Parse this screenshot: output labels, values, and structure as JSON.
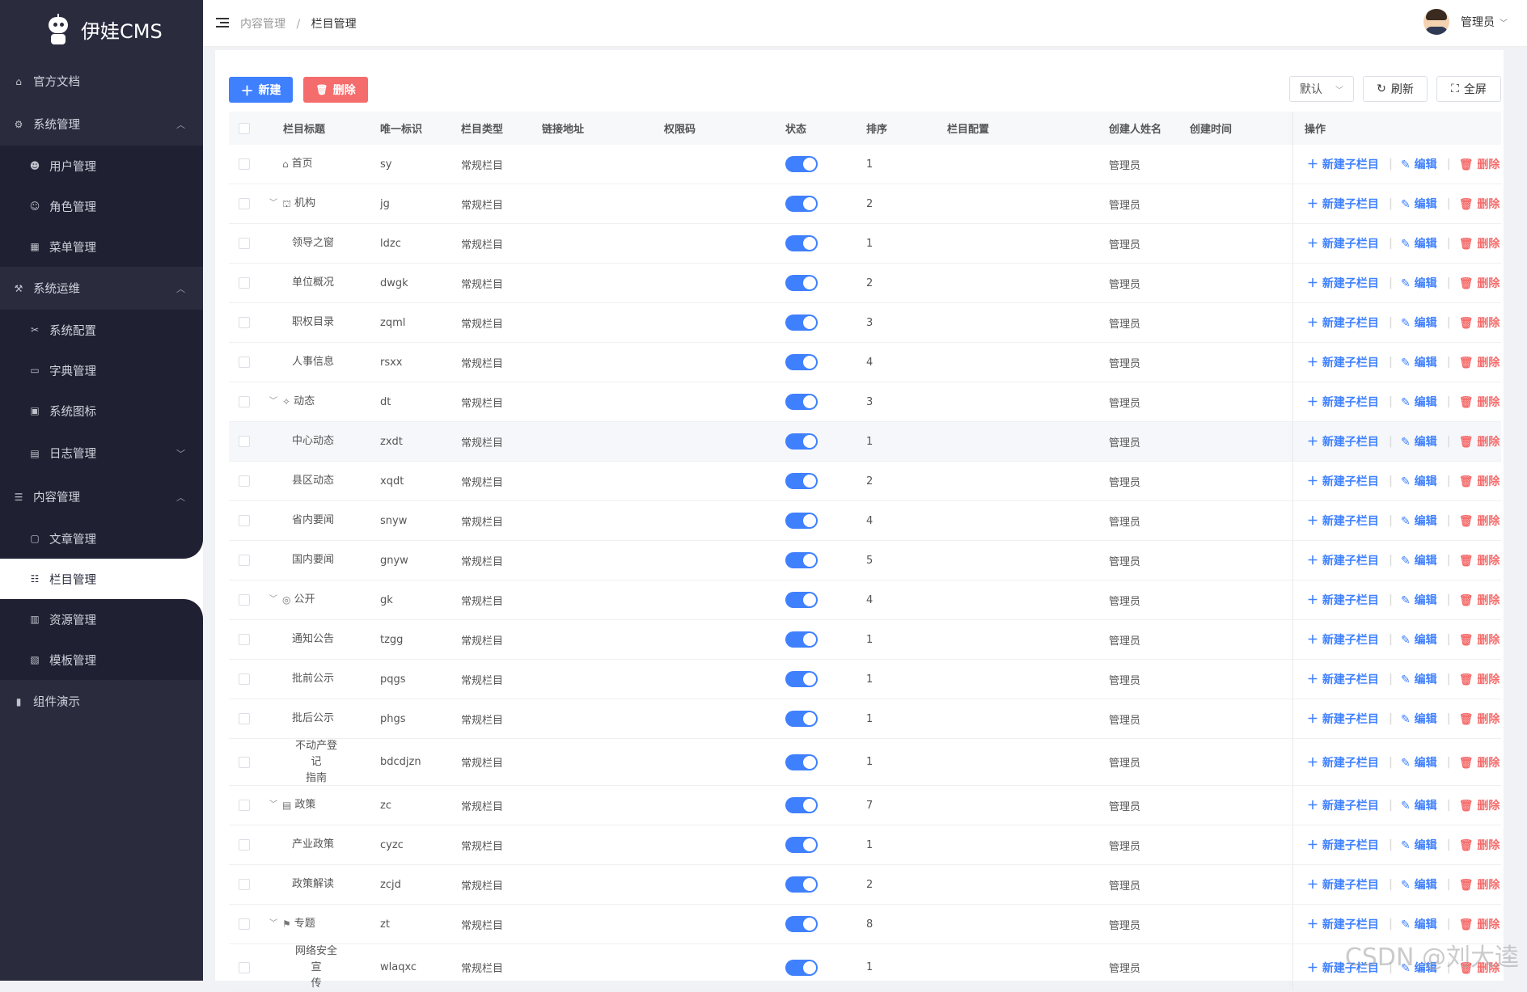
{
  "app": {
    "name": "伊娃CMS"
  },
  "sidebar": {
    "items": [
      {
        "label": "官方文档",
        "icon": "home-icon"
      },
      {
        "label": "系统管理",
        "icon": "gear-icon"
      },
      {
        "label": "用户管理",
        "icon": "user-icon"
      },
      {
        "label": "角色管理",
        "icon": "users-icon"
      },
      {
        "label": "菜单管理",
        "icon": "grid-icon"
      },
      {
        "label": "系统运维",
        "icon": "ops-icon"
      },
      {
        "label": "系统配置",
        "icon": "tool-icon"
      },
      {
        "label": "字典管理",
        "icon": "book-icon"
      },
      {
        "label": "系统图标",
        "icon": "image-icon"
      },
      {
        "label": "日志管理",
        "icon": "log-icon"
      },
      {
        "label": "内容管理",
        "icon": "list-icon"
      },
      {
        "label": "文章管理",
        "icon": "doc-icon"
      },
      {
        "label": "栏目管理",
        "icon": "tree-icon"
      },
      {
        "label": "资源管理",
        "icon": "folder-icon"
      },
      {
        "label": "模板管理",
        "icon": "template-icon"
      },
      {
        "label": "组件演示",
        "icon": "chart-icon"
      }
    ]
  },
  "header": {
    "breadcrumb_parent": "内容管理",
    "breadcrumb_sep": "/",
    "breadcrumb_current": "栏目管理",
    "user_name": "管理员"
  },
  "toolbar": {
    "new_label": "新建",
    "delete_label": "删除",
    "select_value": "默认",
    "refresh_label": "刷新",
    "fullscreen_label": "全屏"
  },
  "table": {
    "columns": [
      "栏目标题",
      "唯一标识",
      "栏目类型",
      "链接地址",
      "权限码",
      "状态",
      "排序",
      "栏目配置",
      "创建人姓名",
      "创建时间",
      "操作"
    ],
    "rows": [
      {
        "title": "首页",
        "key": "sy",
        "type": "常规栏目",
        "sort": "1",
        "user": "管理员"
      },
      {
        "title": "机构",
        "key": "jg",
        "type": "常规栏目",
        "sort": "2",
        "user": "管理员"
      },
      {
        "title": "领导之窗",
        "key": "ldzc",
        "type": "常规栏目",
        "sort": "1",
        "user": "管理员"
      },
      {
        "title": "单位概况",
        "key": "dwgk",
        "type": "常规栏目",
        "sort": "2",
        "user": "管理员"
      },
      {
        "title": "职权目录",
        "key": "zqml",
        "type": "常规栏目",
        "sort": "3",
        "user": "管理员"
      },
      {
        "title": "人事信息",
        "key": "rsxx",
        "type": "常规栏目",
        "sort": "4",
        "user": "管理员"
      },
      {
        "title": "动态",
        "key": "dt",
        "type": "常规栏目",
        "sort": "3",
        "user": "管理员"
      },
      {
        "title": "中心动态",
        "key": "zxdt",
        "type": "常规栏目",
        "sort": "1",
        "user": "管理员"
      },
      {
        "title": "县区动态",
        "key": "xqdt",
        "type": "常规栏目",
        "sort": "2",
        "user": "管理员"
      },
      {
        "title": "省内要闻",
        "key": "snyw",
        "type": "常规栏目",
        "sort": "4",
        "user": "管理员"
      },
      {
        "title": "国内要闻",
        "key": "gnyw",
        "type": "常规栏目",
        "sort": "5",
        "user": "管理员"
      },
      {
        "title": "公开",
        "key": "gk",
        "type": "常规栏目",
        "sort": "4",
        "user": "管理员"
      },
      {
        "title": "通知公告",
        "key": "tzgg",
        "type": "常规栏目",
        "sort": "1",
        "user": "管理员"
      },
      {
        "title": "批前公示",
        "key": "pqgs",
        "type": "常规栏目",
        "sort": "1",
        "user": "管理员"
      },
      {
        "title": "批后公示",
        "key": "phgs",
        "type": "常规栏目",
        "sort": "1",
        "user": "管理员"
      },
      {
        "title": "不动产登记指南",
        "title_line1": "不动产登记",
        "title_line2": "指南",
        "key": "bdcdjzn",
        "type": "常规栏目",
        "sort": "1",
        "user": "管理员"
      },
      {
        "title": "政策",
        "key": "zc",
        "type": "常规栏目",
        "sort": "7",
        "user": "管理员"
      },
      {
        "title": "产业政策",
        "key": "cyzc",
        "type": "常规栏目",
        "sort": "1",
        "user": "管理员"
      },
      {
        "title": "政策解读",
        "key": "zcjd",
        "type": "常规栏目",
        "sort": "2",
        "user": "管理员"
      },
      {
        "title": "专题",
        "key": "zt",
        "type": "常规栏目",
        "sort": "8",
        "user": "管理员"
      },
      {
        "title": "网络安全宣传",
        "title_line1": "网络安全宣",
        "title_line2": "传",
        "key": "wlaqxc",
        "type": "常规栏目",
        "sort": "1",
        "user": "管理员"
      }
    ],
    "op_add": "新建子栏目",
    "op_edit": "编辑",
    "op_delete": "删除"
  },
  "watermark": "CSDN @刘大逵"
}
